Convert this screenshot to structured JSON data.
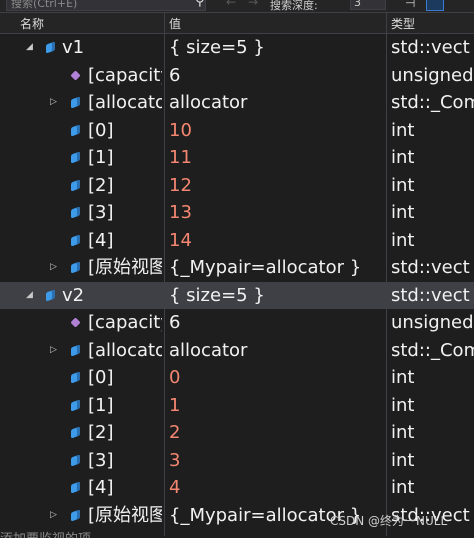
{
  "toolbar": {
    "search_placeholder": "搜索(Ctrl+E)",
    "depth_label": "搜索深度:",
    "depth_value": "3"
  },
  "header": {
    "name": "名称",
    "value": "值",
    "type": "类型"
  },
  "rows": [
    {
      "expander": "◢",
      "icon": "field",
      "name": "v1",
      "value": "{ size=5 }",
      "type": "std::vect",
      "changed": false
    },
    {
      "expander": "",
      "icon": "method",
      "name": "[capacity]",
      "value": "6",
      "type": "unsigned",
      "changed": false
    },
    {
      "expander": "▷",
      "icon": "field",
      "name": "[allocator]",
      "value": "allocator",
      "type": "std::_Com",
      "changed": false
    },
    {
      "expander": "",
      "icon": "field",
      "name": "[0]",
      "value": "10",
      "type": "int",
      "changed": true
    },
    {
      "expander": "",
      "icon": "field",
      "name": "[1]",
      "value": "11",
      "type": "int",
      "changed": true
    },
    {
      "expander": "",
      "icon": "field",
      "name": "[2]",
      "value": "12",
      "type": "int",
      "changed": true
    },
    {
      "expander": "",
      "icon": "field",
      "name": "[3]",
      "value": "13",
      "type": "int",
      "changed": true
    },
    {
      "expander": "",
      "icon": "field",
      "name": "[4]",
      "value": "14",
      "type": "int",
      "changed": true
    },
    {
      "expander": "▷",
      "icon": "field",
      "name": "[原始视图]",
      "value": "{_Mypair=allocator }",
      "type": "std::vect",
      "changed": false
    },
    {
      "expander": "◢",
      "icon": "field",
      "name": "v2",
      "value": "{ size=5 }",
      "type": "std::vect",
      "changed": false,
      "selected": true
    },
    {
      "expander": "",
      "icon": "method",
      "name": "[capacity]",
      "value": "6",
      "type": "unsigned",
      "changed": false
    },
    {
      "expander": "▷",
      "icon": "field",
      "name": "[allocator]",
      "value": "allocator",
      "type": "std::_Com",
      "changed": false
    },
    {
      "expander": "",
      "icon": "field",
      "name": "[0]",
      "value": "0",
      "type": "int",
      "changed": true
    },
    {
      "expander": "",
      "icon": "field",
      "name": "[1]",
      "value": "1",
      "type": "int",
      "changed": true
    },
    {
      "expander": "",
      "icon": "field",
      "name": "[2]",
      "value": "2",
      "type": "int",
      "changed": true
    },
    {
      "expander": "",
      "icon": "field",
      "name": "[3]",
      "value": "3",
      "type": "int",
      "changed": true
    },
    {
      "expander": "",
      "icon": "field",
      "name": "[4]",
      "value": "4",
      "type": "int",
      "changed": true
    },
    {
      "expander": "▷",
      "icon": "field",
      "name": "[原始视图]",
      "value": "{_Mypair=allocator }",
      "type": "std::vect",
      "changed": false
    }
  ],
  "footer": {
    "add_watch_hint": "添加要监视的项",
    "watermark": "CSDN @终为一NULL"
  },
  "colors": {
    "changed_value": "#f48771",
    "selected_row": "#3f3f46",
    "field_icon": "#3d9be9",
    "method_icon": "#b180d7"
  }
}
